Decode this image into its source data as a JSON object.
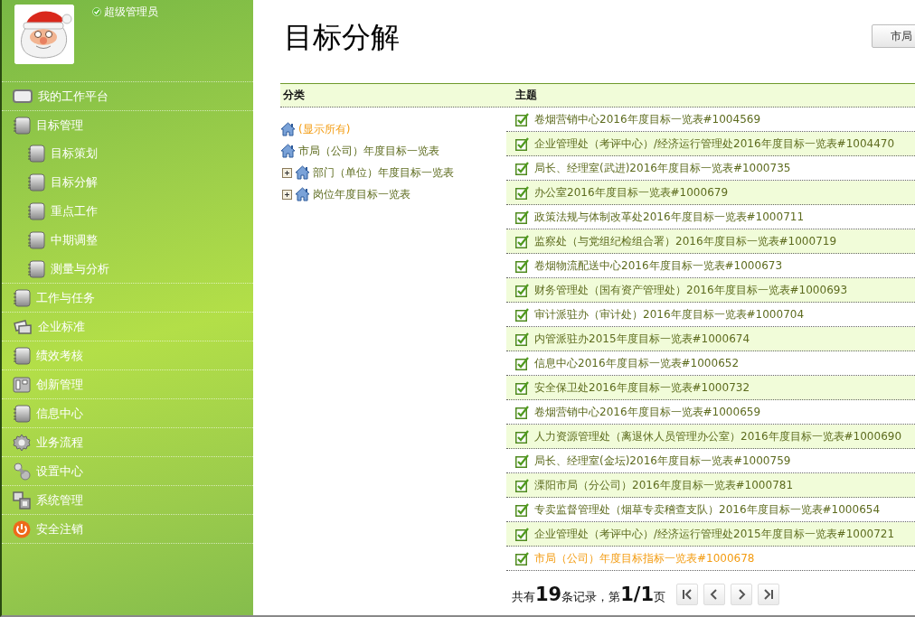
{
  "user": {
    "role": "超级管理员",
    "verified": true
  },
  "nav": [
    {
      "label": "我的工作平台",
      "kind": "monitor"
    },
    {
      "label": "目标管理",
      "kind": "notebook",
      "expanded": true,
      "children": [
        {
          "label": "目标策划",
          "kind": "notebook"
        },
        {
          "label": "目标分解",
          "kind": "notebook"
        },
        {
          "label": "重点工作",
          "kind": "notebook"
        },
        {
          "label": "中期调整",
          "kind": "notebook"
        },
        {
          "label": "测量与分析",
          "kind": "notebook"
        }
      ]
    },
    {
      "label": "工作与任务",
      "kind": "notebook"
    },
    {
      "label": "企业标准",
      "kind": "cards"
    },
    {
      "label": "绩效考核",
      "kind": "notebook"
    },
    {
      "label": "创新管理",
      "kind": "book"
    },
    {
      "label": "信息中心",
      "kind": "notebook"
    },
    {
      "label": "业务流程",
      "kind": "gear"
    },
    {
      "label": "设置中心",
      "kind": "link"
    },
    {
      "label": "系统管理",
      "kind": "windows"
    },
    {
      "label": "安全注销",
      "kind": "power"
    }
  ],
  "page": {
    "title": "目标分解",
    "button": "市局"
  },
  "table": {
    "columns": [
      "分类",
      "主题"
    ]
  },
  "tree": [
    {
      "label": "(显示所有)",
      "kind": "leaf",
      "selected": true
    },
    {
      "label": "市局（公司）年度目标一览表",
      "kind": "leaf",
      "selected": false
    },
    {
      "label": "部门（单位）年度目标一览表",
      "kind": "group",
      "expanded": false,
      "selected": false
    },
    {
      "label": "岗位年度目标一览表",
      "kind": "group",
      "expanded": false,
      "selected": false
    }
  ],
  "rows": [
    {
      "title": "卷烟营销中心2016年度目标一览表#1004569",
      "checked": true,
      "selected": false
    },
    {
      "title": "企业管理处（考评中心）/经济运行管理处2016年度目标一览表#1004470",
      "checked": true,
      "selected": false
    },
    {
      "title": "局长、经理室(武进)2016年度目标一览表#1000735",
      "checked": true,
      "selected": false
    },
    {
      "title": "办公室2016年度目标一览表#1000679",
      "checked": true,
      "selected": false
    },
    {
      "title": "政策法规与体制改革处2016年度目标一览表#1000711",
      "checked": true,
      "selected": false
    },
    {
      "title": "监察处（与党组纪检组合署）2016年度目标一览表#1000719",
      "checked": true,
      "selected": false
    },
    {
      "title": "卷烟物流配送中心2016年度目标一览表#1000673",
      "checked": true,
      "selected": false
    },
    {
      "title": "财务管理处（国有资产管理处）2016年度目标一览表#1000693",
      "checked": true,
      "selected": false
    },
    {
      "title": "审计派驻办（审计处）2016年度目标一览表#1000704",
      "checked": true,
      "selected": false
    },
    {
      "title": "内管派驻办2015年度目标一览表#1000674",
      "checked": true,
      "selected": false
    },
    {
      "title": "信息中心2016年度目标一览表#1000652",
      "checked": true,
      "selected": false
    },
    {
      "title": "安全保卫处2016年度目标一览表#1000732",
      "checked": true,
      "selected": false
    },
    {
      "title": "卷烟营销中心2016年度目标一览表#1000659",
      "checked": true,
      "selected": false
    },
    {
      "title": "人力资源管理处（离退休人员管理办公室）2016年度目标一览表#1000690",
      "checked": true,
      "selected": false
    },
    {
      "title": "局长、经理室(金坛)2016年度目标一览表#1000759",
      "checked": true,
      "selected": false
    },
    {
      "title": "溧阳市局（分公司）2016年度目标一览表#1000781",
      "checked": true,
      "selected": false
    },
    {
      "title": "专卖监督管理处（烟草专卖稽查支队）2016年度目标一览表#1000654",
      "checked": true,
      "selected": false
    },
    {
      "title": "企业管理处（考评中心）/经济运行管理处2015年度目标一览表#1000721",
      "checked": true,
      "selected": false
    },
    {
      "title": "市局（公司）年度目标指标一览表#1000678",
      "checked": true,
      "selected": true
    }
  ],
  "pager": {
    "summary": "共有**19**条记录，第**1/1**页"
  }
}
